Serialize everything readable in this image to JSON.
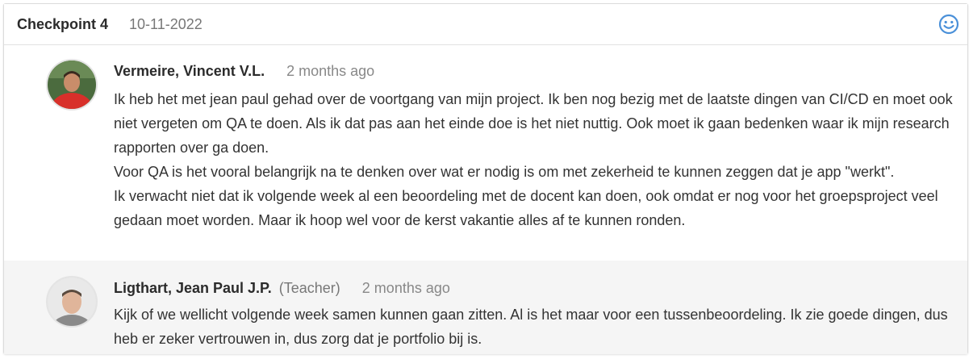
{
  "checkpoint": {
    "title": "Checkpoint 4",
    "date": "10-11-2022",
    "icon": "smiley-icon"
  },
  "comments": [
    {
      "author": "Vermeire, Vincent V.L.",
      "role": "",
      "time": "2 months ago",
      "paragraphs": [
        "Ik heb het met jean paul gehad over de voortgang van mijn project. Ik ben nog bezig met de laatste dingen van CI/CD en moet ook niet vergeten om QA te doen. Als ik dat pas aan het einde doe is het niet nuttig. Ook moet ik gaan bedenken waar ik mijn research rapporten over ga doen.",
        "Voor QA is het vooral belangrijk na te denken over wat er nodig is om met zekerheid te kunnen zeggen dat je app \"werkt\".",
        "Ik verwacht niet dat ik volgende week al een beoordeling met de docent kan doen, ook omdat er nog voor het groepsproject veel gedaan moet worden. Maar ik hoop wel voor de kerst vakantie alles af te kunnen ronden."
      ]
    },
    {
      "author": "Ligthart, Jean Paul J.P.",
      "role": "(Teacher)",
      "time": "2 months ago",
      "paragraphs": [
        "Kijk of we wellicht volgende week samen kunnen gaan zitten. Al is het maar voor een tussenbeoordeling. Ik zie goede dingen, dus heb er zeker vertrouwen in, dus zorg dat je portfolio bij is."
      ]
    }
  ],
  "colors": {
    "accent_icon": "#4a90d9",
    "teacher_row_bg": "#f5f5f5"
  }
}
